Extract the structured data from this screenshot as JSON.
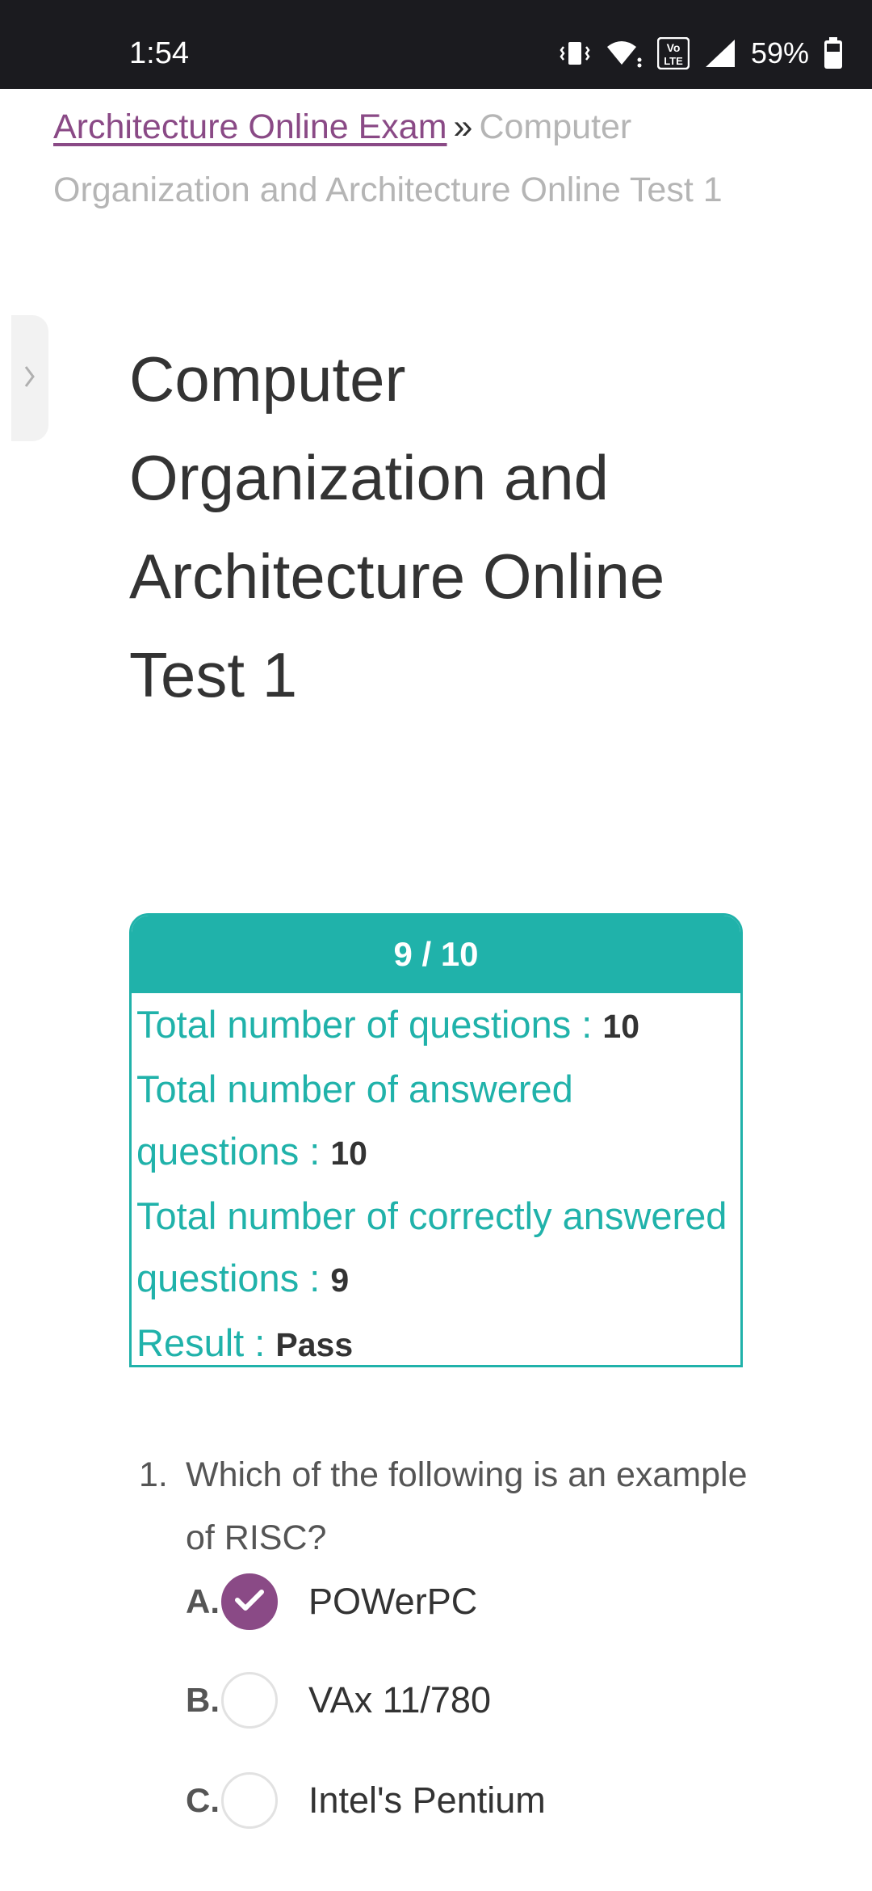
{
  "status_bar": {
    "time": "1:54",
    "battery": "59%",
    "network_badge": "Vo LTE",
    "icons": [
      "vibrate-icon",
      "wifi-icon",
      "volte-icon",
      "signal-icon",
      "battery-icon"
    ]
  },
  "breadcrumb": {
    "link": "Architecture Online Exam",
    "separator": "»",
    "current": "Computer Organization and Architecture Online Test 1"
  },
  "page": {
    "title": "Computer Organization and Architecture Online Test 1"
  },
  "score": {
    "header": "9 / 10",
    "total_label": "Total number of questions : ",
    "total_value": "10",
    "answered_label": "Total number of answered questions : ",
    "answered_value": "10",
    "correct_label": "Total number of correctly answered questions : ",
    "correct_value": "9",
    "result_label": "Result : ",
    "result_value": "Pass"
  },
  "question": {
    "number": "1.",
    "text": "Which of the following is an example of RISC?",
    "options": [
      {
        "letter": "A.",
        "text": "POWerPC",
        "selected": true
      },
      {
        "letter": "B.",
        "text": "VAx 11/780",
        "selected": false
      },
      {
        "letter": "C.",
        "text": "Intel's Pentium",
        "selected": false
      }
    ]
  },
  "colors": {
    "accent_teal": "#20b2aa",
    "accent_purple": "#8a4a86"
  }
}
